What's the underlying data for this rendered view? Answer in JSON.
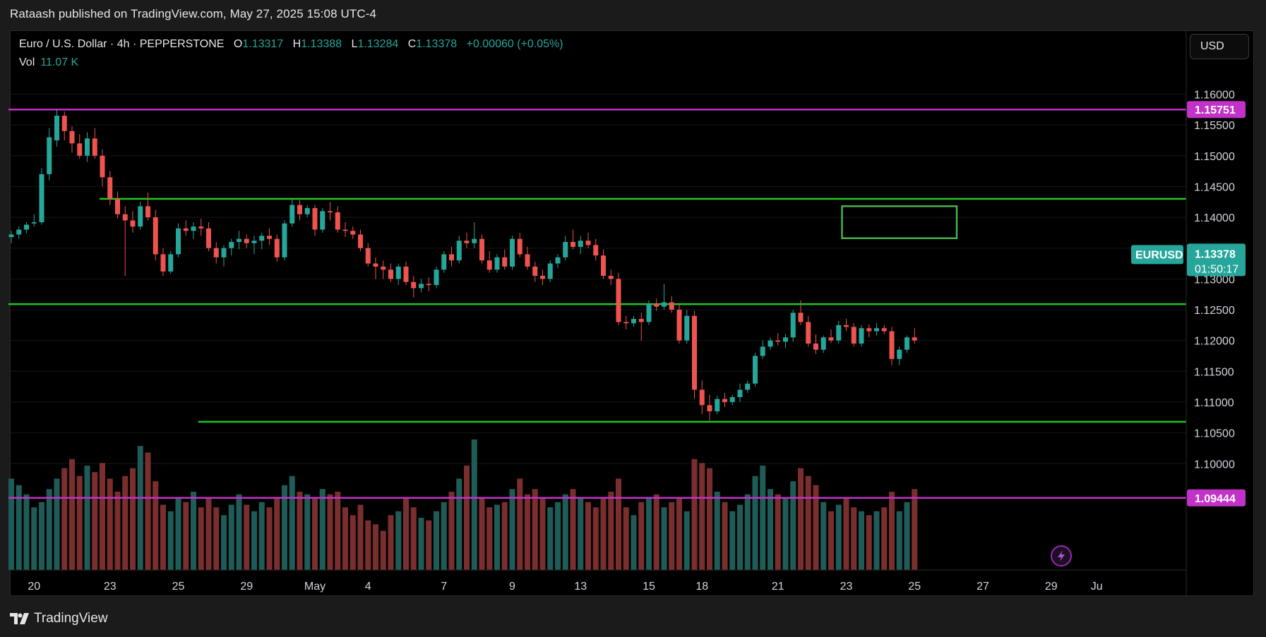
{
  "header": {
    "published_text": "Rataash published on TradingView.com, May 27, 2025 15:08 UTC-4"
  },
  "legend": {
    "symbol": "Euro / U.S. Dollar · 4h · PEPPERSTONE",
    "o_label": "O",
    "o_value": "1.13317",
    "h_label": "H",
    "h_value": "1.13388",
    "l_label": "L",
    "l_value": "1.13284",
    "c_label": "C",
    "c_value": "1.13378",
    "change": "+0.00060 (+0.05%)",
    "vol_label": "Vol",
    "vol_value": "11.07 K"
  },
  "currency_button": "USD",
  "brand": {
    "name": "TradingView",
    "logo_icon": "tradingview-logo-icon"
  },
  "colors": {
    "up": "#26a69a",
    "down": "#ef5350",
    "vol_up": "#1f5c57",
    "vol_down": "#7a2e2e",
    "level_green": "#22c522",
    "level_purple": "#c231c8",
    "box_green": "#4caf50"
  },
  "chart_data": {
    "type": "candlestick",
    "symbol": "EURUSD",
    "timeframe": "4h",
    "ylim": [
      1.0935,
      1.162
    ],
    "y_ticks": [
      "1.16000",
      "1.15500",
      "1.15000",
      "1.14500",
      "1.14000",
      "1.13500",
      "1.13000",
      "1.12500",
      "1.12000",
      "1.11500",
      "1.11000",
      "1.10500",
      "1.10000"
    ],
    "x_ticks": [
      {
        "label": "20",
        "index": 3
      },
      {
        "label": "23",
        "index": 13
      },
      {
        "label": "25",
        "index": 22
      },
      {
        "label": "29",
        "index": 31
      },
      {
        "label": "May",
        "index": 40
      },
      {
        "label": "4",
        "index": 47
      },
      {
        "label": "7",
        "index": 57
      },
      {
        "label": "9",
        "index": 66
      },
      {
        "label": "13",
        "index": 75
      },
      {
        "label": "15",
        "index": 84
      },
      {
        "label": "18",
        "index": 91
      },
      {
        "label": "21",
        "index": 101
      },
      {
        "label": "23",
        "index": 110
      },
      {
        "label": "25",
        "index": 119
      },
      {
        "label": "27",
        "index": 128
      },
      {
        "label": "29",
        "index": 137
      },
      {
        "label": "Ju",
        "index": 143
      }
    ],
    "horizontal_levels": [
      {
        "price": 1.15751,
        "color": "purple",
        "label": "1.15751",
        "from_index": 0
      },
      {
        "price": 1.143,
        "color": "green",
        "from_index": 12
      },
      {
        "price": 1.1259,
        "color": "green",
        "from_index": 0
      },
      {
        "price": 1.1068,
        "color": "green",
        "from_index": 25
      },
      {
        "price": 1.09444,
        "color": "purple",
        "label": "1.09444",
        "from_index": 0
      }
    ],
    "box": {
      "from_index": 110,
      "to_index": 124,
      "high": 1.1418,
      "low": 1.1366
    },
    "price_tags": {
      "symbol": "EURUSD",
      "last_price": "1.13378",
      "countdown": "01:50:17"
    },
    "candles": [
      {
        "o": 1.1368,
        "h": 1.1378,
        "l": 1.1358,
        "c": 1.1372,
        "v": 70
      },
      {
        "o": 1.1372,
        "h": 1.1385,
        "l": 1.1365,
        "c": 1.138,
        "v": 65
      },
      {
        "o": 1.138,
        "h": 1.1392,
        "l": 1.1374,
        "c": 1.1388,
        "v": 58
      },
      {
        "o": 1.139,
        "h": 1.1405,
        "l": 1.1385,
        "c": 1.1392,
        "v": 48
      },
      {
        "o": 1.1392,
        "h": 1.148,
        "l": 1.1388,
        "c": 1.147,
        "v": 52
      },
      {
        "o": 1.147,
        "h": 1.1545,
        "l": 1.146,
        "c": 1.153,
        "v": 62
      },
      {
        "o": 1.1525,
        "h": 1.1575,
        "l": 1.1515,
        "c": 1.1565,
        "v": 70
      },
      {
        "o": 1.1565,
        "h": 1.1572,
        "l": 1.1525,
        "c": 1.154,
        "v": 78
      },
      {
        "o": 1.154,
        "h": 1.1548,
        "l": 1.1505,
        "c": 1.152,
        "v": 85
      },
      {
        "o": 1.152,
        "h": 1.1535,
        "l": 1.1495,
        "c": 1.15,
        "v": 72
      },
      {
        "o": 1.15,
        "h": 1.1538,
        "l": 1.149,
        "c": 1.1528,
        "v": 80
      },
      {
        "o": 1.1528,
        "h": 1.1545,
        "l": 1.1495,
        "c": 1.15,
        "v": 75
      },
      {
        "o": 1.15,
        "h": 1.151,
        "l": 1.145,
        "c": 1.1465,
        "v": 82
      },
      {
        "o": 1.1465,
        "h": 1.1475,
        "l": 1.142,
        "c": 1.143,
        "v": 70
      },
      {
        "o": 1.143,
        "h": 1.1442,
        "l": 1.1398,
        "c": 1.1405,
        "v": 60
      },
      {
        "o": 1.1405,
        "h": 1.1418,
        "l": 1.1305,
        "c": 1.1395,
        "v": 72
      },
      {
        "o": 1.1395,
        "h": 1.141,
        "l": 1.1375,
        "c": 1.1385,
        "v": 78
      },
      {
        "o": 1.1385,
        "h": 1.1425,
        "l": 1.138,
        "c": 1.1418,
        "v": 95
      },
      {
        "o": 1.1418,
        "h": 1.144,
        "l": 1.1395,
        "c": 1.14,
        "v": 90
      },
      {
        "o": 1.14,
        "h": 1.1412,
        "l": 1.133,
        "c": 1.134,
        "v": 68
      },
      {
        "o": 1.134,
        "h": 1.135,
        "l": 1.1305,
        "c": 1.1312,
        "v": 50
      },
      {
        "o": 1.1312,
        "h": 1.1345,
        "l": 1.1308,
        "c": 1.134,
        "v": 45
      },
      {
        "o": 1.134,
        "h": 1.139,
        "l": 1.1335,
        "c": 1.1382,
        "v": 55
      },
      {
        "o": 1.1382,
        "h": 1.1395,
        "l": 1.137,
        "c": 1.1378,
        "v": 52
      },
      {
        "o": 1.1378,
        "h": 1.1392,
        "l": 1.1365,
        "c": 1.1385,
        "v": 60
      },
      {
        "o": 1.1385,
        "h": 1.1398,
        "l": 1.137,
        "c": 1.1382,
        "v": 48
      },
      {
        "o": 1.1382,
        "h": 1.1392,
        "l": 1.1345,
        "c": 1.135,
        "v": 55
      },
      {
        "o": 1.135,
        "h": 1.136,
        "l": 1.1325,
        "c": 1.1335,
        "v": 48
      },
      {
        "o": 1.1335,
        "h": 1.1355,
        "l": 1.132,
        "c": 1.135,
        "v": 42
      },
      {
        "o": 1.135,
        "h": 1.1365,
        "l": 1.1338,
        "c": 1.136,
        "v": 50
      },
      {
        "o": 1.136,
        "h": 1.1378,
        "l": 1.1348,
        "c": 1.1365,
        "v": 58
      },
      {
        "o": 1.1365,
        "h": 1.1372,
        "l": 1.135,
        "c": 1.1358,
        "v": 50
      },
      {
        "o": 1.1358,
        "h": 1.137,
        "l": 1.134,
        "c": 1.1362,
        "v": 45
      },
      {
        "o": 1.1362,
        "h": 1.1375,
        "l": 1.1348,
        "c": 1.137,
        "v": 52
      },
      {
        "o": 1.137,
        "h": 1.1382,
        "l": 1.1355,
        "c": 1.1365,
        "v": 48
      },
      {
        "o": 1.1365,
        "h": 1.1372,
        "l": 1.1328,
        "c": 1.1335,
        "v": 55
      },
      {
        "o": 1.1335,
        "h": 1.1395,
        "l": 1.133,
        "c": 1.139,
        "v": 65
      },
      {
        "o": 1.139,
        "h": 1.143,
        "l": 1.1385,
        "c": 1.142,
        "v": 72
      },
      {
        "o": 1.142,
        "h": 1.1428,
        "l": 1.1395,
        "c": 1.1405,
        "v": 60
      },
      {
        "o": 1.1405,
        "h": 1.142,
        "l": 1.14,
        "c": 1.1415,
        "v": 58
      },
      {
        "o": 1.1415,
        "h": 1.142,
        "l": 1.137,
        "c": 1.138,
        "v": 55
      },
      {
        "o": 1.138,
        "h": 1.1415,
        "l": 1.1375,
        "c": 1.141,
        "v": 62
      },
      {
        "o": 1.141,
        "h": 1.1425,
        "l": 1.1395,
        "c": 1.1408,
        "v": 58
      },
      {
        "o": 1.1408,
        "h": 1.1418,
        "l": 1.1375,
        "c": 1.138,
        "v": 60
      },
      {
        "o": 1.138,
        "h": 1.1392,
        "l": 1.1368,
        "c": 1.1378,
        "v": 48
      },
      {
        "o": 1.1378,
        "h": 1.1385,
        "l": 1.1365,
        "c": 1.1372,
        "v": 42
      },
      {
        "o": 1.1372,
        "h": 1.138,
        "l": 1.1345,
        "c": 1.135,
        "v": 50
      },
      {
        "o": 1.135,
        "h": 1.1358,
        "l": 1.132,
        "c": 1.1325,
        "v": 38
      },
      {
        "o": 1.1325,
        "h": 1.1335,
        "l": 1.13,
        "c": 1.132,
        "v": 35
      },
      {
        "o": 1.132,
        "h": 1.133,
        "l": 1.13,
        "c": 1.1315,
        "v": 30
      },
      {
        "o": 1.1315,
        "h": 1.1325,
        "l": 1.1295,
        "c": 1.13,
        "v": 42
      },
      {
        "o": 1.13,
        "h": 1.1325,
        "l": 1.129,
        "c": 1.132,
        "v": 45
      },
      {
        "o": 1.132,
        "h": 1.1328,
        "l": 1.129,
        "c": 1.1295,
        "v": 55
      },
      {
        "o": 1.1295,
        "h": 1.1305,
        "l": 1.127,
        "c": 1.1285,
        "v": 48
      },
      {
        "o": 1.1285,
        "h": 1.13,
        "l": 1.1278,
        "c": 1.1292,
        "v": 40
      },
      {
        "o": 1.1292,
        "h": 1.1302,
        "l": 1.128,
        "c": 1.129,
        "v": 38
      },
      {
        "o": 1.129,
        "h": 1.132,
        "l": 1.1285,
        "c": 1.1315,
        "v": 45
      },
      {
        "o": 1.1315,
        "h": 1.1345,
        "l": 1.131,
        "c": 1.134,
        "v": 52
      },
      {
        "o": 1.134,
        "h": 1.1352,
        "l": 1.132,
        "c": 1.133,
        "v": 60
      },
      {
        "o": 1.133,
        "h": 1.137,
        "l": 1.1325,
        "c": 1.1362,
        "v": 70
      },
      {
        "o": 1.1362,
        "h": 1.1375,
        "l": 1.135,
        "c": 1.1358,
        "v": 80
      },
      {
        "o": 1.1358,
        "h": 1.1392,
        "l": 1.135,
        "c": 1.1365,
        "v": 100
      },
      {
        "o": 1.1365,
        "h": 1.1372,
        "l": 1.1325,
        "c": 1.133,
        "v": 55
      },
      {
        "o": 1.133,
        "h": 1.1345,
        "l": 1.131,
        "c": 1.1315,
        "v": 48
      },
      {
        "o": 1.1315,
        "h": 1.134,
        "l": 1.131,
        "c": 1.1335,
        "v": 50
      },
      {
        "o": 1.1335,
        "h": 1.1348,
        "l": 1.1315,
        "c": 1.132,
        "v": 52
      },
      {
        "o": 1.132,
        "h": 1.137,
        "l": 1.1315,
        "c": 1.1365,
        "v": 62
      },
      {
        "o": 1.1365,
        "h": 1.1375,
        "l": 1.1335,
        "c": 1.134,
        "v": 70
      },
      {
        "o": 1.134,
        "h": 1.1352,
        "l": 1.1315,
        "c": 1.132,
        "v": 58
      },
      {
        "o": 1.132,
        "h": 1.1328,
        "l": 1.1295,
        "c": 1.1305,
        "v": 62
      },
      {
        "o": 1.1305,
        "h": 1.1315,
        "l": 1.129,
        "c": 1.13,
        "v": 55
      },
      {
        "o": 1.13,
        "h": 1.133,
        "l": 1.1295,
        "c": 1.1325,
        "v": 48
      },
      {
        "o": 1.1325,
        "h": 1.134,
        "l": 1.1318,
        "c": 1.1335,
        "v": 52
      },
      {
        "o": 1.1335,
        "h": 1.137,
        "l": 1.133,
        "c": 1.136,
        "v": 58
      },
      {
        "o": 1.136,
        "h": 1.138,
        "l": 1.1348,
        "c": 1.1352,
        "v": 62
      },
      {
        "o": 1.1352,
        "h": 1.137,
        "l": 1.134,
        "c": 1.1362,
        "v": 55
      },
      {
        "o": 1.1362,
        "h": 1.1375,
        "l": 1.135,
        "c": 1.1355,
        "v": 52
      },
      {
        "o": 1.1355,
        "h": 1.1365,
        "l": 1.133,
        "c": 1.1338,
        "v": 48
      },
      {
        "o": 1.1338,
        "h": 1.1348,
        "l": 1.13,
        "c": 1.1305,
        "v": 55
      },
      {
        "o": 1.1305,
        "h": 1.1315,
        "l": 1.129,
        "c": 1.13,
        "v": 60
      },
      {
        "o": 1.13,
        "h": 1.131,
        "l": 1.1225,
        "c": 1.123,
        "v": 70
      },
      {
        "o": 1.123,
        "h": 1.124,
        "l": 1.1218,
        "c": 1.1228,
        "v": 48
      },
      {
        "o": 1.1228,
        "h": 1.124,
        "l": 1.1222,
        "c": 1.1235,
        "v": 42
      },
      {
        "o": 1.1235,
        "h": 1.1245,
        "l": 1.12,
        "c": 1.123,
        "v": 52
      },
      {
        "o": 1.123,
        "h": 1.1265,
        "l": 1.1225,
        "c": 1.126,
        "v": 56
      },
      {
        "o": 1.126,
        "h": 1.1268,
        "l": 1.1248,
        "c": 1.1255,
        "v": 58
      },
      {
        "o": 1.1255,
        "h": 1.1292,
        "l": 1.125,
        "c": 1.1262,
        "v": 48
      },
      {
        "o": 1.1262,
        "h": 1.1272,
        "l": 1.1245,
        "c": 1.125,
        "v": 52
      },
      {
        "o": 1.125,
        "h": 1.1258,
        "l": 1.1195,
        "c": 1.12,
        "v": 55
      },
      {
        "o": 1.12,
        "h": 1.125,
        "l": 1.1195,
        "c": 1.124,
        "v": 45
      },
      {
        "o": 1.124,
        "h": 1.1248,
        "l": 1.1105,
        "c": 1.112,
        "v": 85
      },
      {
        "o": 1.112,
        "h": 1.1135,
        "l": 1.108,
        "c": 1.1095,
        "v": 82
      },
      {
        "o": 1.1095,
        "h": 1.1112,
        "l": 1.107,
        "c": 1.1085,
        "v": 78
      },
      {
        "o": 1.1085,
        "h": 1.111,
        "l": 1.108,
        "c": 1.1105,
        "v": 60
      },
      {
        "o": 1.1105,
        "h": 1.1115,
        "l": 1.1092,
        "c": 1.11,
        "v": 52
      },
      {
        "o": 1.11,
        "h": 1.1112,
        "l": 1.1095,
        "c": 1.1108,
        "v": 45
      },
      {
        "o": 1.1108,
        "h": 1.113,
        "l": 1.11,
        "c": 1.112,
        "v": 50
      },
      {
        "o": 1.112,
        "h": 1.1135,
        "l": 1.1115,
        "c": 1.113,
        "v": 58
      },
      {
        "o": 1.113,
        "h": 1.118,
        "l": 1.1125,
        "c": 1.1175,
        "v": 72
      },
      {
        "o": 1.1175,
        "h": 1.12,
        "l": 1.117,
        "c": 1.119,
        "v": 80
      },
      {
        "o": 1.119,
        "h": 1.1205,
        "l": 1.1185,
        "c": 1.12,
        "v": 62
      },
      {
        "o": 1.12,
        "h": 1.1212,
        "l": 1.1192,
        "c": 1.1198,
        "v": 58
      },
      {
        "o": 1.1198,
        "h": 1.121,
        "l": 1.1188,
        "c": 1.1205,
        "v": 55
      },
      {
        "o": 1.1205,
        "h": 1.125,
        "l": 1.1198,
        "c": 1.1245,
        "v": 68
      },
      {
        "o": 1.1245,
        "h": 1.1265,
        "l": 1.1225,
        "c": 1.123,
        "v": 78
      },
      {
        "o": 1.123,
        "h": 1.124,
        "l": 1.119,
        "c": 1.1195,
        "v": 72
      },
      {
        "o": 1.1195,
        "h": 1.121,
        "l": 1.1178,
        "c": 1.1185,
        "v": 65
      },
      {
        "o": 1.1185,
        "h": 1.1208,
        "l": 1.118,
        "c": 1.1205,
        "v": 52
      },
      {
        "o": 1.1205,
        "h": 1.1218,
        "l": 1.1196,
        "c": 1.12,
        "v": 45
      },
      {
        "o": 1.12,
        "h": 1.1232,
        "l": 1.1195,
        "c": 1.1225,
        "v": 50
      },
      {
        "o": 1.1225,
        "h": 1.1235,
        "l": 1.1215,
        "c": 1.1222,
        "v": 55
      },
      {
        "o": 1.1222,
        "h": 1.1228,
        "l": 1.119,
        "c": 1.1195,
        "v": 48
      },
      {
        "o": 1.1195,
        "h": 1.1225,
        "l": 1.119,
        "c": 1.122,
        "v": 45
      },
      {
        "o": 1.122,
        "h": 1.1226,
        "l": 1.1205,
        "c": 1.1215,
        "v": 42
      },
      {
        "o": 1.1215,
        "h": 1.1228,
        "l": 1.1208,
        "c": 1.122,
        "v": 45
      },
      {
        "o": 1.122,
        "h": 1.1225,
        "l": 1.121,
        "c": 1.1215,
        "v": 48
      },
      {
        "o": 1.1215,
        "h": 1.1222,
        "l": 1.116,
        "c": 1.117,
        "v": 60
      },
      {
        "o": 1.117,
        "h": 1.119,
        "l": 1.116,
        "c": 1.1185,
        "v": 45
      },
      {
        "o": 1.1185,
        "h": 1.1208,
        "l": 1.118,
        "c": 1.1205,
        "v": 52
      },
      {
        "o": 1.1205,
        "h": 1.122,
        "l": 1.1195,
        "c": 1.12,
        "v": 62
      }
    ]
  }
}
